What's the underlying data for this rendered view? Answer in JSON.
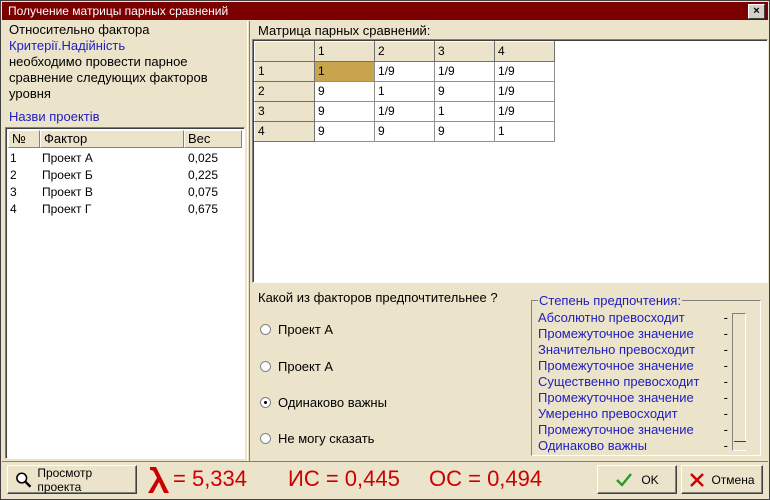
{
  "window": {
    "title": "Получение матрицы парных сравнений",
    "close": "×"
  },
  "context": {
    "line1": "Относительно фактора",
    "factor": "Критерії.Надійність",
    "line3": "необходимо провести парное",
    "line4": "сравнение следующих факторов",
    "line5": "уровня",
    "projects_link": "Назви проектів"
  },
  "factors": {
    "headers": [
      "№",
      "Фактор",
      "Вес"
    ],
    "rows": [
      {
        "n": "1",
        "name": "Проект А",
        "w": "0,025"
      },
      {
        "n": "2",
        "name": "Проект Б",
        "w": "0,225"
      },
      {
        "n": "3",
        "name": "Проект В",
        "w": "0,075"
      },
      {
        "n": "4",
        "name": "Проект Г",
        "w": "0,675"
      }
    ]
  },
  "matrix": {
    "label": "Матрица парных сравнений:",
    "cols": [
      "1",
      "2",
      "3",
      "4"
    ],
    "rows": [
      {
        "h": "1",
        "c": [
          "1",
          "1/9",
          "1/9",
          "1/9"
        ]
      },
      {
        "h": "2",
        "c": [
          "9",
          "1",
          "9",
          "1/9"
        ]
      },
      {
        "h": "3",
        "c": [
          "9",
          "1/9",
          "1",
          "1/9"
        ]
      },
      {
        "h": "4",
        "c": [
          "9",
          "9",
          "9",
          "1"
        ]
      }
    ]
  },
  "question": {
    "text": "Какой из факторов предпочтительнее ?",
    "options": [
      "Проект А",
      "Проект А",
      "Одинаково важны",
      "Не могу сказать"
    ],
    "selected_index": 2
  },
  "preference": {
    "caption": "Степень предпочтения:",
    "items": [
      "Абсолютно превосходит",
      "Промежуточное значение",
      "Значительно превосходит",
      "Промежуточное значение",
      "Существенно превосходит",
      "Промежуточное значение",
      "Умеренно превосходит",
      "Промежуточное значение",
      "Одинаково важны"
    ],
    "dash": "-",
    "slider_level": 0
  },
  "bottom": {
    "view_button": "Просмотр проекта",
    "lambda": "= 5,334",
    "ci": "ИС = 0,445",
    "cr": "ОС = 0,494",
    "ok": "OK",
    "cancel": "Отмена"
  },
  "colors": {
    "accent_red": "#cc0000",
    "title_bar": "#7b0000",
    "link_blue": "#2020c0",
    "selected_cell": "#c8a44c"
  }
}
